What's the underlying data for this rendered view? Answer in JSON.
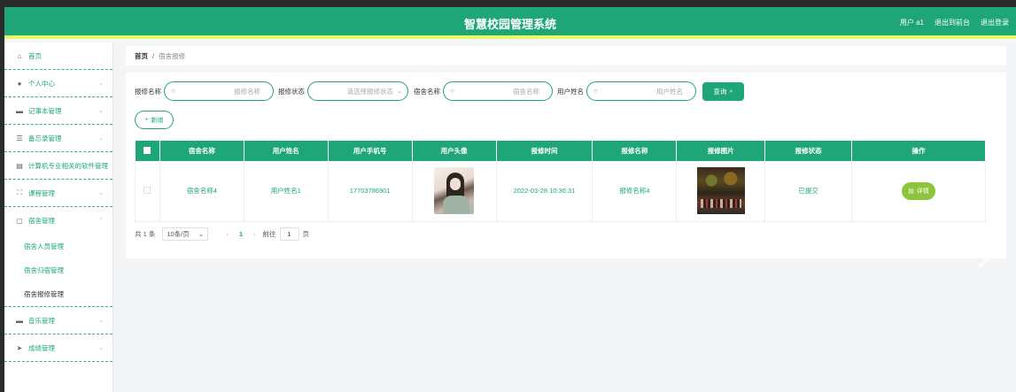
{
  "header": {
    "title": "智慧校园管理系统",
    "user_label": "用户 a1",
    "exit_front_label": "退出到前台",
    "logout_label": "退出登录"
  },
  "sidebar": {
    "items": [
      {
        "label": "首页",
        "icon": "home-icon"
      },
      {
        "label": "个人中心",
        "icon": "user-icon"
      },
      {
        "label": "记事本管理",
        "icon": "notebook-icon"
      },
      {
        "label": "备忘录管理",
        "icon": "sliders-icon"
      },
      {
        "label": "计算机专业相关的软件管理",
        "icon": "clipboard-icon"
      },
      {
        "label": "课程管理",
        "icon": "fullscreen-icon"
      },
      {
        "label": "宿舍管理",
        "icon": "chat-icon"
      },
      {
        "label": "音乐管理",
        "icon": "music-icon"
      },
      {
        "label": "成绩管理",
        "icon": "send-icon"
      }
    ],
    "dorm_sub": [
      "宿舍人员管理",
      "宿舍归宿管理",
      "宿舍报修管理"
    ]
  },
  "breadcrumb": {
    "home": "首页",
    "sep": "/",
    "current": "宿舍报修"
  },
  "search": {
    "repair_name_label": "报修名称",
    "repair_name_placeholder": "报修名称",
    "repair_status_label": "报修状态",
    "repair_status_placeholder": "请选择报修状态",
    "dorm_name_label": "宿舍名称",
    "dorm_name_placeholder": "宿舍名称",
    "user_name_label": "用户姓名",
    "user_name_placeholder": "用户姓名",
    "query_label": "查询"
  },
  "add_label": "新增",
  "table": {
    "headers": [
      "宿舍名称",
      "用户姓名",
      "用户手机号",
      "用户头像",
      "报修时间",
      "报修名称",
      "报修图片",
      "报修状态",
      "操作"
    ],
    "rows": [
      {
        "dorm_name": "宿舍名称4",
        "user_name": "用户姓名1",
        "phone": "17703786901",
        "time": "2022-03-28 10:36:31",
        "repair_name": "报修名称4",
        "status": "已提交",
        "action": "详情"
      }
    ]
  },
  "pager": {
    "total": "共 1 条",
    "page_size": "10条/页",
    "prev": "‹",
    "current_page": "1",
    "next": "›",
    "goto_prefix": "前往",
    "goto_value": "1",
    "goto_suffix": "页"
  },
  "colors": {
    "primary": "#1ea678",
    "accent_bar": "#e8f96a",
    "detail_button": "#8cc43c"
  }
}
